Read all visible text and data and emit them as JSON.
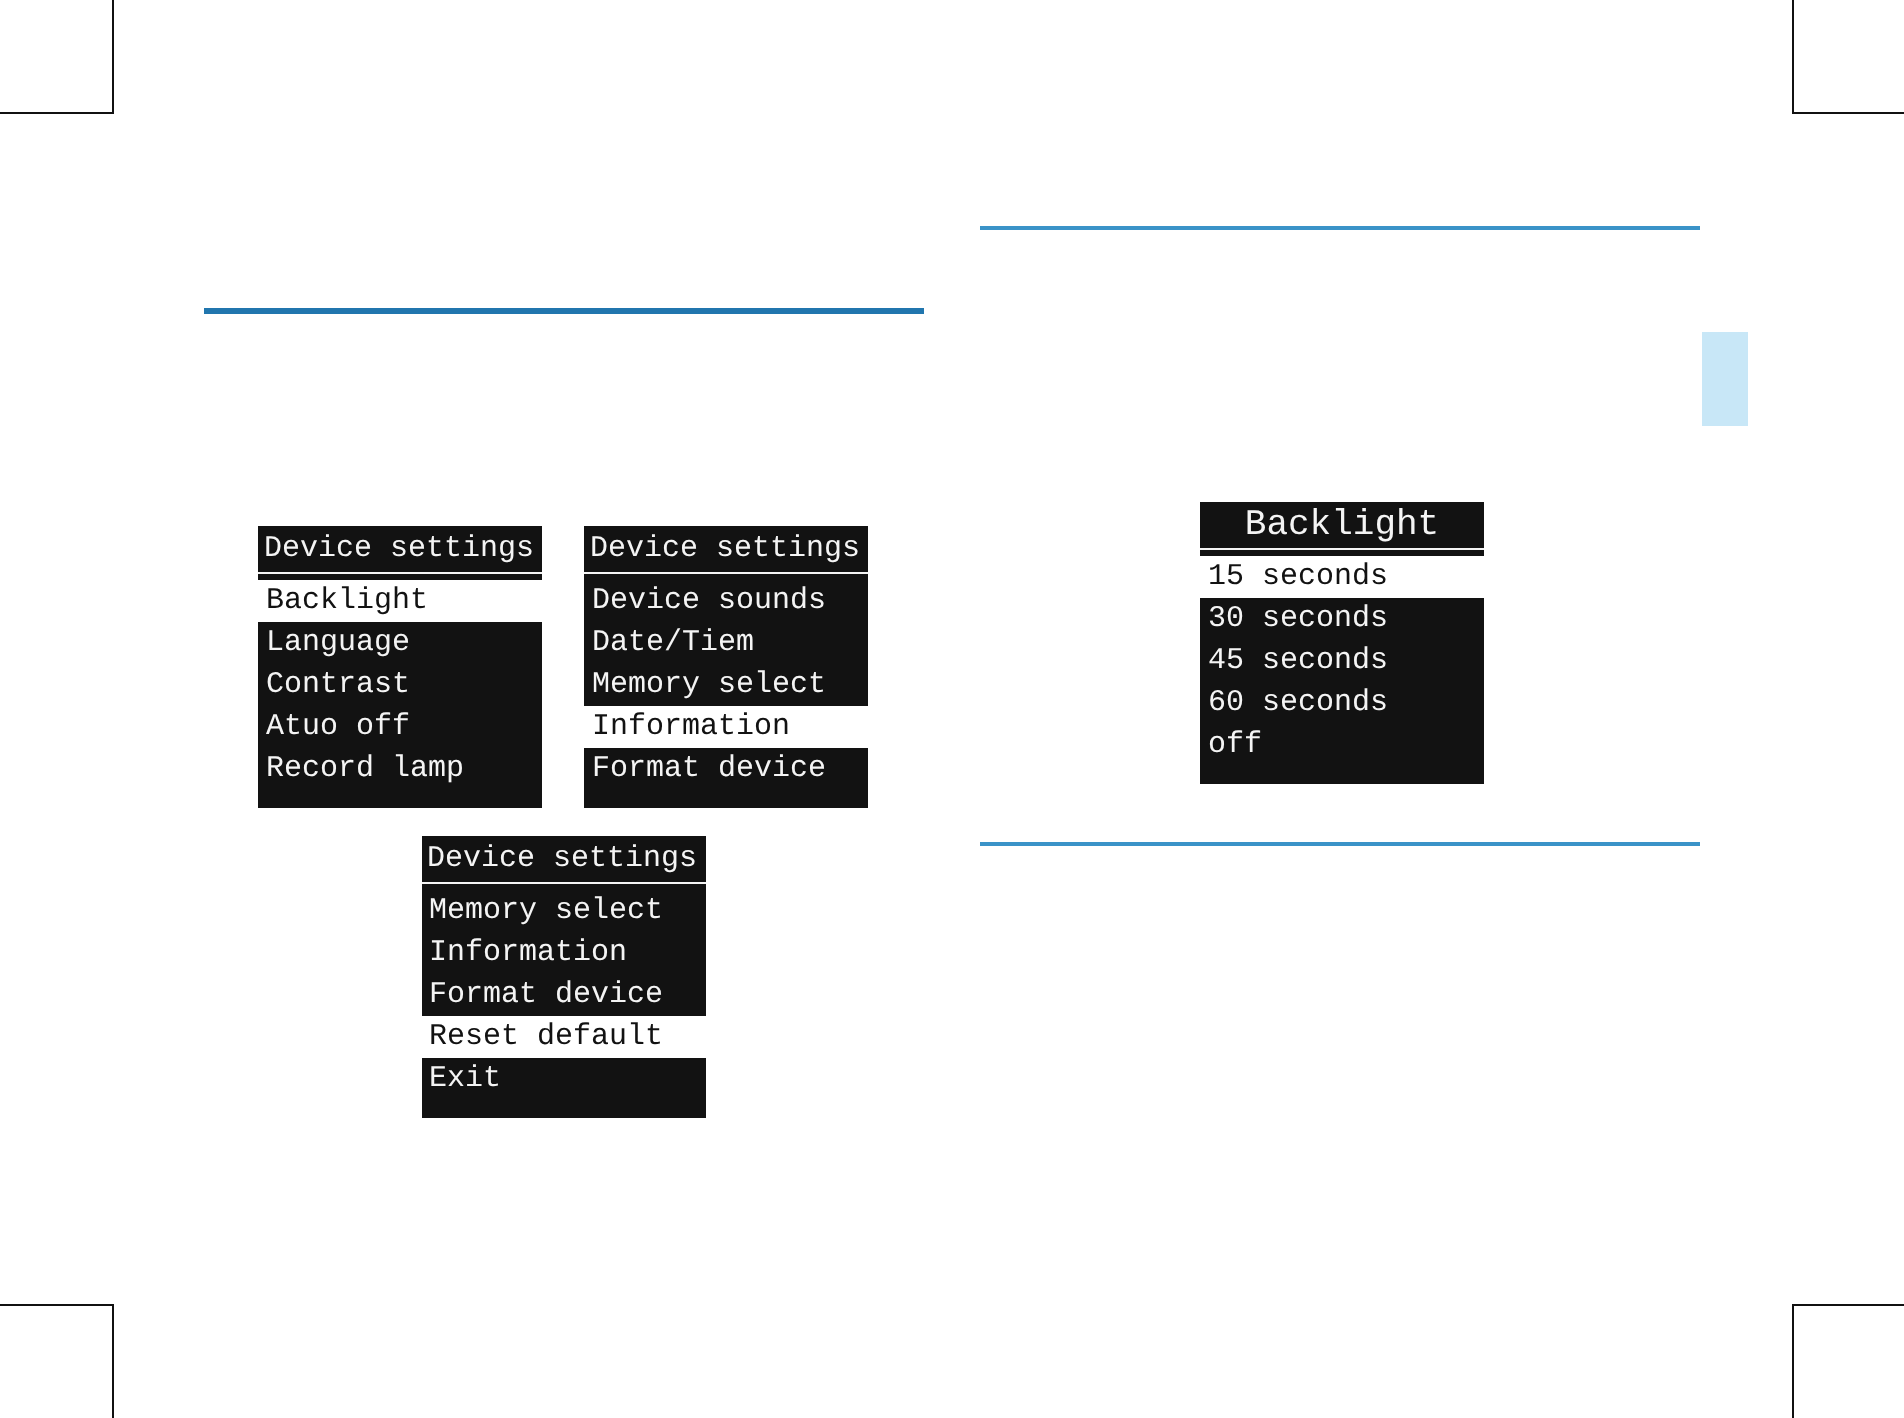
{
  "left_page": {
    "screens": [
      {
        "kind": "menu",
        "title": "Device settings",
        "items": [
          {
            "label": "Backlight",
            "selected": true
          },
          {
            "label": "Language",
            "selected": false
          },
          {
            "label": "Contrast",
            "selected": false
          },
          {
            "label": "Atuo off",
            "selected": false
          },
          {
            "label": "Record lamp",
            "selected": false
          }
        ]
      },
      {
        "kind": "menu",
        "title": "Device settings",
        "items": [
          {
            "label": "Device sounds",
            "selected": false
          },
          {
            "label": "Date/Tiem",
            "selected": false
          },
          {
            "label": "Memory select",
            "selected": false
          },
          {
            "label": "Information",
            "selected": true
          },
          {
            "label": "Format device",
            "selected": false
          }
        ]
      },
      {
        "kind": "menu",
        "title": "Device settings",
        "items": [
          {
            "label": "Memory select",
            "selected": false
          },
          {
            "label": "Information",
            "selected": false
          },
          {
            "label": "Format device",
            "selected": false
          },
          {
            "label": "Reset default",
            "selected": true
          },
          {
            "label": "Exit",
            "selected": false
          }
        ]
      }
    ]
  },
  "right_page": {
    "screens": [
      {
        "kind": "submenu",
        "title": "Backlight",
        "items": [
          {
            "label": "15 seconds",
            "selected": true
          },
          {
            "label": "30 seconds",
            "selected": false
          },
          {
            "label": "45 seconds",
            "selected": false
          },
          {
            "label": "60 seconds",
            "selected": false
          },
          {
            "label": "off",
            "selected": false
          }
        ]
      }
    ]
  }
}
